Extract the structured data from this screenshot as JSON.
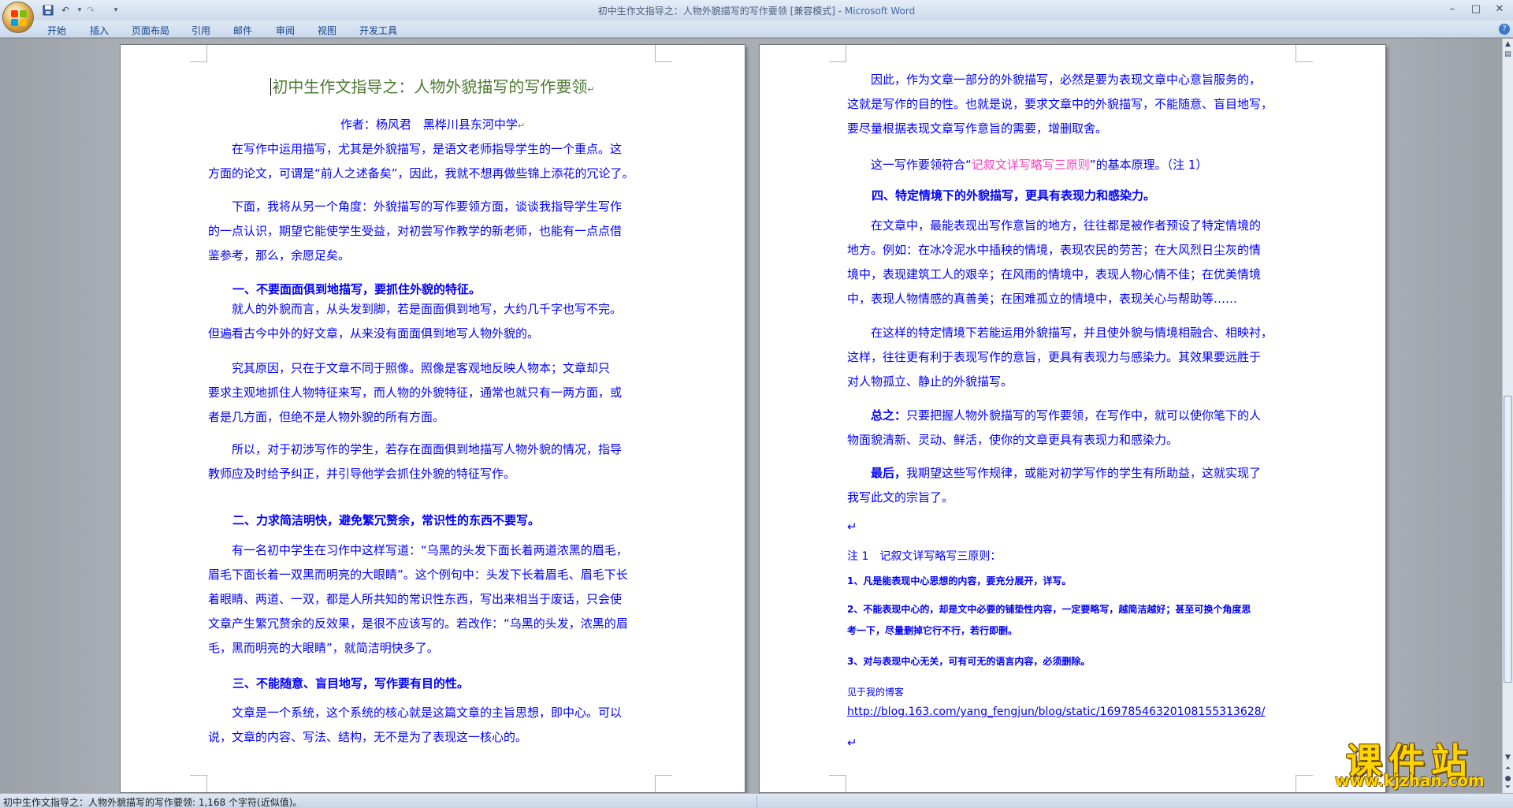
{
  "window": {
    "title_doc": "初中生作文指导之：人物外貌描写的写作要领 [兼容模式] - ",
    "title_app": "Microsoft Word",
    "brand_colors": [
      "#ff3b00",
      "#7bbf00",
      "#00a2ed",
      "#ffb900"
    ]
  },
  "qat": {
    "save_icon": "save-icon",
    "undo_icon": "undo-icon",
    "redo_icon": "redo-icon",
    "customize_icon": "chevron-down-icon"
  },
  "ribbon": {
    "tabs": [
      "开始",
      "插入",
      "页面布局",
      "引用",
      "邮件",
      "审阅",
      "视图",
      "开发工具"
    ]
  },
  "document": {
    "title": "初中生作文指导之：人物外貌描写的写作要领",
    "author": "作者：杨风君　黑桦川县东河中学",
    "left": {
      "p1": [
        "在写作中运用描写，尤其是外貌描写，是语文老师指导学生的一个重点。这",
        "方面的论文，可谓是“前人之述备矣”，因此，我就不想再做些锦上添花的冗论了。"
      ],
      "p2": [
        "下面，我将从另一个角度：外貌描写的写作要领方面，谈谈我指导学生写作",
        "的一点认识，期望它能使学生受益，对初尝写作教学的新老师，也能有一点点借",
        "鉴参考，那么，余愿足矣。"
      ],
      "h1": "一、不要面面俱到地描写，要抓住外貌的特征。",
      "p3": [
        "就人的外貌而言，从头发到脚，若是面面俱到地写，大约几千字也写不完。",
        "但遍看古今中外的好文章，从来没有面面俱到地写人物外貌的。"
      ],
      "p4": [
        "究其原因，只在于文章不同于照像。照像是客观地反映人物本；文章却只",
        "要求主观地抓住人物特征来写，而人物的外貌特征，通常也就只有一两方面，或",
        "者是几方面，但绝不是人物外貌的所有方面。"
      ],
      "p5": [
        "所以，对于初涉写作的学生，若存在面面俱到地描写人物外貌的情况，指导",
        "教师应及时给予纠正，并引导他学会抓住外貌的特征写作。"
      ],
      "h2": "二、力求简洁明快，避免繁冗赘余，常识性的东西不要写。",
      "p6": [
        "有一名初中学生在习作中这样写道：“乌黑的头发下面长着两道浓黑的眉毛，",
        "眉毛下面长着一双黑而明亮的大眼睛”。这个例句中：头发下长着眉毛、眉毛下长",
        "着眼睛、两道、一双，都是人所共知的常识性东西，写出来相当于废话，只会使",
        "文章产生繁冗赘余的反效果，是很不应该写的。若改作：“乌黑的头发，浓黑的眉",
        "毛，黑而明亮的大眼睛”，就简洁明快多了。"
      ],
      "h3": "三、不能随意、盲目地写，写作要有目的性。",
      "p7": [
        "文章是一个系统，这个系统的核心就是这篇文章的主旨思想，即中心。可以",
        "说，文章的内容、写法、结构，无不是为了表现这一核心的。"
      ]
    },
    "right": {
      "p1": [
        "因此，作为文章一部分的外貌描写，必然是要为表现文章中心意旨服务的，",
        "这就是写作的目的性。也就是说，要求文章中的外貌描写，不能随意、盲目地写，",
        "要尽量根据表现文章写作意旨的需要，增删取舍。"
      ],
      "p2_a": "这一写作要领符合“",
      "p2_link": "记叙文详写略写三原则",
      "p2_b": "”的基本原理。（注 1）",
      "h4": "四、特定情境下的外貌描写，更具有表现力和感染力。",
      "p3": [
        "在文章中，最能表现出写作意旨的地方，往往都是被作者预设了特定情境的",
        "地方。例如：在冰冷泥水中插秧的情境，表现农民的劳苦；在大风烈日尘灰的情",
        "境中，表现建筑工人的艰辛；在风雨的情境中，表现人物心情不佳；在优美情境",
        "中，表现人物情感的真善美；在困难孤立的情境中，表现关心与帮助等……"
      ],
      "p4": [
        "在这样的特定情境下若能运用外貌描写，并且使外貌与情境相融合、相映衬，",
        "这样，往往更有利于表现写作的意旨，更具有表现力与感染力。其效果要远胜于",
        "对人物孤立、静止的外貌描写。"
      ],
      "p5_b": "总之：",
      "p5": [
        "只要把握人物外貌描写的写作要领，在写作中，就可以使你笔下的人",
        "物面貌清新、灵动、鲜活，使你的文章更具有表现力和感染力。"
      ],
      "p6_b": "最后，",
      "p6": [
        "我期望这些写作规律，或能对初学写作的学生有所助益，这就实现了",
        "我写此文的宗旨了。"
      ],
      "note_title": "注 1　记叙文详写略写三原则：",
      "note1": "1、凡是能表现中心思想的内容，要充分展开，详写。",
      "note2": [
        "2、不能表现中心的，却是文中必要的铺垫性内容，一定要略写，越简洁越好；甚至可换个角度思",
        "考一下，尽量删掉它行不行，若行即删。"
      ],
      "note3": "3、对与表现中心无关，可有可无的语言内容，必须删除。",
      "blog_label": "见于我的博客",
      "blog_url": "http://blog.163.com/yang_fengjun/blog/static/16978546320108155313628/"
    },
    "para_mark": "↵"
  },
  "status": {
    "text": "初中生作文指导之：人物外貌描写的写作要领: 1,168 个字符(近似值)。"
  },
  "watermark": {
    "cn": "课件站",
    "url": "www.kjzhan.com"
  }
}
